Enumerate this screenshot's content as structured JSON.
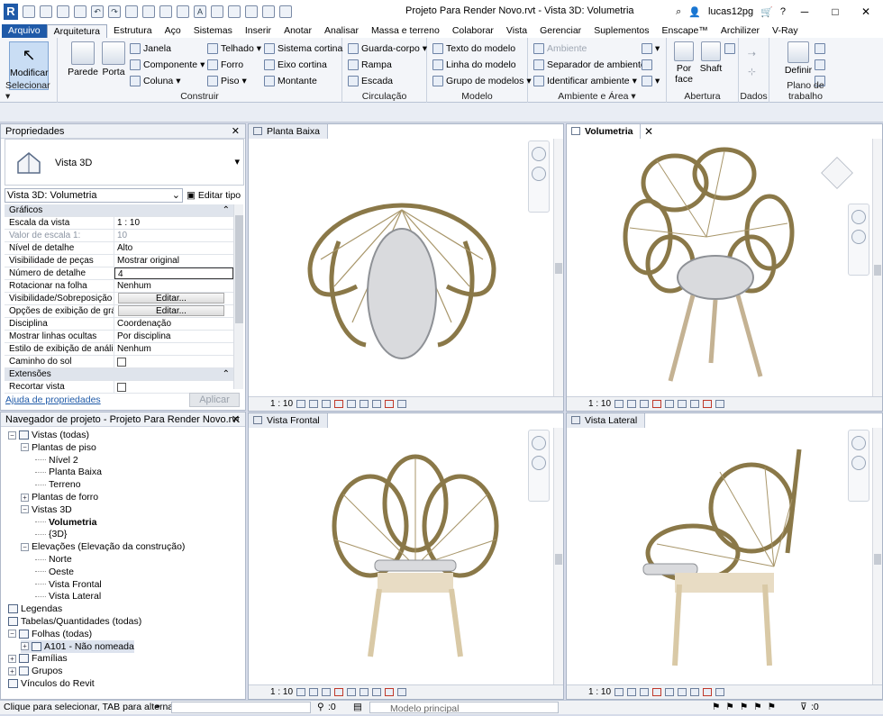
{
  "title_bar": {
    "title": "Projeto Para Render Novo.rvt - Vista 3D: Volumetria",
    "user": "lucas12pg",
    "app_logo": "R"
  },
  "tabs": [
    "Arquivo",
    "Arquitetura",
    "Estrutura",
    "Aço",
    "Sistemas",
    "Inserir",
    "Anotar",
    "Analisar",
    "Massa e terreno",
    "Colaborar",
    "Vista",
    "Gerenciar",
    "Suplementos",
    "Enscape™",
    "Archilizer",
    "V-Ray"
  ],
  "ribbon": {
    "modificar": "Modificar",
    "selecionar": "Selecionar",
    "parede": "Parede",
    "porta": "Porta",
    "janela": "Janela",
    "componente": "Componente",
    "coluna": "Coluna",
    "telhado": "Telhado",
    "forro": "Forro",
    "piso": "Piso",
    "sistema_cortina": "Sistema cortina",
    "eixo_cortina": "Eixo cortina",
    "montante": "Montante",
    "construir": "Construir",
    "guarda_corpo": "Guarda-corpo",
    "rampa": "Rampa",
    "escada": "Escada",
    "circulacao": "Circulação",
    "texto_modelo": "Texto do modelo",
    "linha_modelo": "Linha do modelo",
    "grupo_modelos": "Grupo de modelos",
    "modelo": "Modelo",
    "ambiente": "Ambiente",
    "separador": "Separador de ambiente",
    "identificar": "Identificar ambiente",
    "ambiente_area": "Ambiente e Área",
    "por_face": "Por face",
    "shaft": "Shaft",
    "abertura": "Abertura",
    "dados": "Dados",
    "definir": "Definir",
    "plano_trabalho": "Plano de trabalho"
  },
  "properties": {
    "header": "Propriedades",
    "type_name": "Vista 3D",
    "view_selector": "Vista 3D: Volumetria",
    "edit_type": "Editar tipo",
    "section_graficos": "Gráficos",
    "rows": [
      {
        "k": "Escala da vista",
        "v": "1 : 10"
      },
      {
        "k": "Valor de escala    1:",
        "v": "10"
      },
      {
        "k": "Nível de detalhe",
        "v": "Alto"
      },
      {
        "k": "Visibilidade de peças",
        "v": "Mostrar original"
      },
      {
        "k": "Número de detalhe",
        "v": "4"
      },
      {
        "k": "Rotacionar na folha",
        "v": "Nenhum"
      },
      {
        "k": "Visibilidade/Sobreposição ...",
        "v": "Editar..."
      },
      {
        "k": "Opções de exibição de grá...",
        "v": "Editar..."
      },
      {
        "k": "Disciplina",
        "v": "Coordenação"
      },
      {
        "k": "Mostrar linhas ocultas",
        "v": "Por disciplina"
      },
      {
        "k": "Estilo de exibição de anális...",
        "v": "Nenhum"
      },
      {
        "k": "Caminho do sol",
        "v": ""
      }
    ],
    "section_extensoes": "Extensões",
    "recortar": "Recortar vista",
    "help_link": "Ajuda de propriedades",
    "apply": "Aplicar"
  },
  "browser": {
    "header": "Navegador de projeto - Projeto Para Render Novo.rvt",
    "items": [
      {
        "t": "Vistas (todas)",
        "lvl": 0,
        "pm": "-"
      },
      {
        "t": "Plantas de piso",
        "lvl": 1,
        "pm": "-"
      },
      {
        "t": "Nível 2",
        "lvl": 2,
        "pm": ""
      },
      {
        "t": "Planta Baixa",
        "lvl": 2,
        "pm": ""
      },
      {
        "t": "Terreno",
        "lvl": 2,
        "pm": ""
      },
      {
        "t": "Plantas de forro",
        "lvl": 1,
        "pm": "+"
      },
      {
        "t": "Vistas 3D",
        "lvl": 1,
        "pm": "-"
      },
      {
        "t": "Volumetria",
        "lvl": 2,
        "pm": ""
      },
      {
        "t": "{3D}",
        "lvl": 2,
        "pm": ""
      },
      {
        "t": "Elevações (Elevação da construção)",
        "lvl": 1,
        "pm": "-"
      },
      {
        "t": "Norte",
        "lvl": 2,
        "pm": ""
      },
      {
        "t": "Oeste",
        "lvl": 2,
        "pm": ""
      },
      {
        "t": "Vista Frontal",
        "lvl": 2,
        "pm": ""
      },
      {
        "t": "Vista Lateral",
        "lvl": 2,
        "pm": ""
      },
      {
        "t": "Legendas",
        "lvl": 0,
        "pm": ""
      },
      {
        "t": "Tabelas/Quantidades (todas)",
        "lvl": 0,
        "pm": ""
      },
      {
        "t": "Folhas (todas)",
        "lvl": 0,
        "pm": "-"
      },
      {
        "t": "A101 - Não nomeada",
        "lvl": 1,
        "pm": "+"
      },
      {
        "t": "Famílias",
        "lvl": 0,
        "pm": "+"
      },
      {
        "t": "Grupos",
        "lvl": 0,
        "pm": "+"
      },
      {
        "t": "Vínculos do Revit",
        "lvl": 0,
        "pm": ""
      }
    ]
  },
  "views": {
    "planta": {
      "tab": "Planta Baixa",
      "scale": "1 : 10"
    },
    "volumetria": {
      "tab": "Volumetria",
      "scale": "1 : 10"
    },
    "frontal": {
      "tab": "Vista Frontal",
      "scale": "1 : 10"
    },
    "lateral": {
      "tab": "Vista Lateral",
      "scale": "1 : 10"
    }
  },
  "status": {
    "message": "Clique para selecionar, TAB para alternat",
    "count": ":0",
    "model": "Modelo principal",
    "filter": ":0"
  }
}
